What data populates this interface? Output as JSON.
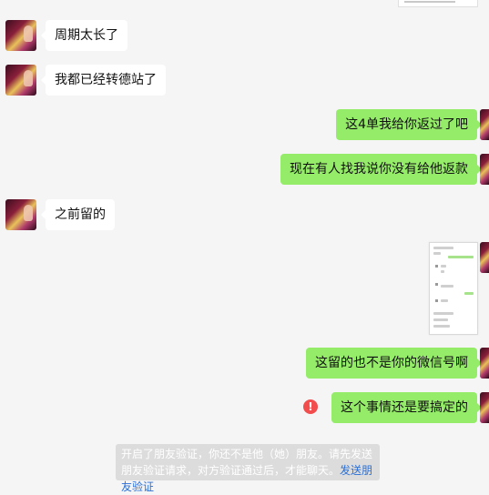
{
  "messages": [
    {
      "side": "left",
      "text": "周期太长了"
    },
    {
      "side": "left",
      "text": "我都已经转德站了"
    },
    {
      "side": "right",
      "text": "这4单我给你返过了吧"
    },
    {
      "side": "right",
      "text": "现在有人找我说你没有给他返款"
    },
    {
      "side": "left",
      "text": "之前留的"
    },
    {
      "side": "right",
      "text": "这留的也不是你的微信号啊"
    },
    {
      "side": "right",
      "text": "这个事情还是要搞定的",
      "status": "send-failed"
    }
  ],
  "error_icon_glyph": "!",
  "system_notice": {
    "text": "开启了朋友验证，你还不是他（她）朋友。请先发送朋友验证请求，对方验证通过后，才能聊天。",
    "link": "发送朋友验证"
  }
}
